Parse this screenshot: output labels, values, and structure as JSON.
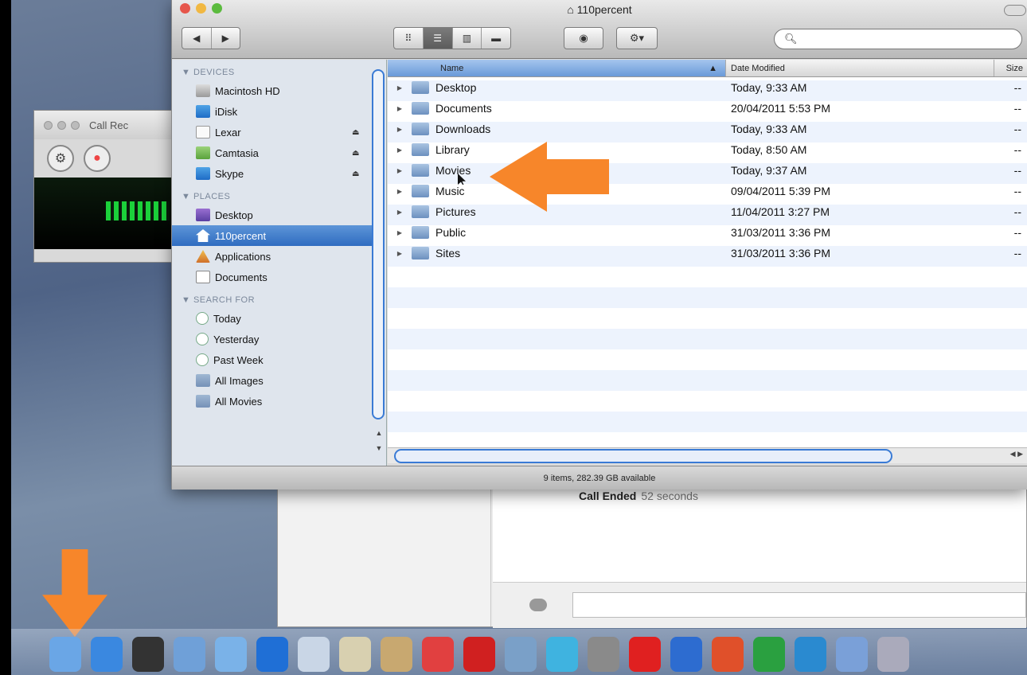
{
  "callrec": {
    "title": "Call Rec"
  },
  "chat": {
    "status": "Call Ended",
    "duration": "52 seconds"
  },
  "finder": {
    "title": "110percent",
    "search_placeholder": "",
    "view_buttons": [
      "",
      "",
      "",
      ""
    ],
    "sidebar": {
      "sections": [
        {
          "header": "▼ DEVICES",
          "items": [
            {
              "label": "Macintosh HD",
              "icon": "hd-icon",
              "eject": false
            },
            {
              "label": "iDisk",
              "icon": "idisk-icon",
              "eject": false
            },
            {
              "label": "Lexar",
              "icon": "drive-icon",
              "eject": true
            },
            {
              "label": "Camtasia",
              "icon": "disk-image-icon",
              "eject": true
            },
            {
              "label": "Skype",
              "icon": "disk-image-icon",
              "eject": true
            }
          ]
        },
        {
          "header": "▼ PLACES",
          "items": [
            {
              "label": "Desktop",
              "icon": "desktop-icon"
            },
            {
              "label": "110percent",
              "icon": "home-icon",
              "selected": true
            },
            {
              "label": "Applications",
              "icon": "applications-icon"
            },
            {
              "label": "Documents",
              "icon": "documents-icon"
            }
          ]
        },
        {
          "header": "▼ SEARCH FOR",
          "items": [
            {
              "label": "Today",
              "icon": "clock-icon"
            },
            {
              "label": "Yesterday",
              "icon": "clock-icon"
            },
            {
              "label": "Past Week",
              "icon": "clock-icon"
            },
            {
              "label": "All Images",
              "icon": "folder-icon"
            },
            {
              "label": "All Movies",
              "icon": "folder-icon"
            }
          ]
        }
      ]
    },
    "columns": {
      "name": "Name",
      "date": "Date Modified",
      "size": "Size"
    },
    "files": [
      {
        "name": "Desktop",
        "date": "Today, 9:33 AM",
        "size": "--"
      },
      {
        "name": "Documents",
        "date": "20/04/2011 5:53 PM",
        "size": "--"
      },
      {
        "name": "Downloads",
        "date": "Today, 9:33 AM",
        "size": "--"
      },
      {
        "name": "Library",
        "date": "Today, 8:50 AM",
        "size": "--"
      },
      {
        "name": "Movies",
        "date": "Today, 9:37 AM",
        "size": "--"
      },
      {
        "name": "Music",
        "date": "09/04/2011 5:39 PM",
        "size": "--"
      },
      {
        "name": "Pictures",
        "date": "11/04/2011 3:27 PM",
        "size": "--"
      },
      {
        "name": "Public",
        "date": "31/03/2011 3:36 PM",
        "size": "--"
      },
      {
        "name": "Sites",
        "date": "31/03/2011 3:36 PM",
        "size": "--"
      }
    ],
    "status": "9 items, 282.39 GB available"
  },
  "dock": {
    "items": [
      "finder-icon",
      "app-store-icon",
      "dashboard-icon",
      "preview-icon",
      "mail-icon",
      "itunes-icon",
      "facetime-icon",
      "photo-icon",
      "contacts-icon",
      "calendar-icon",
      "photobooth-icon",
      "iphoto-icon",
      "time-machine-icon",
      "system-preferences-icon",
      "vodafone-icon",
      "word-icon",
      "powerpoint-icon",
      "excel-icon",
      "messenger-icon",
      "network-icon",
      "misc-icon"
    ],
    "colors": [
      "#6aa6e6",
      "#3a88e0",
      "#333",
      "#6fa0d8",
      "#7ab2e8",
      "#1f6fd6",
      "#c9d6e6",
      "#d8d0b0",
      "#c8a870",
      "#e14040",
      "#d02020",
      "#7aa0c8",
      "#3fb3e0",
      "#8a8a8a",
      "#e02020",
      "#2d6cd0",
      "#e0502a",
      "#2aa040",
      "#2a8ad0",
      "#7aa0d8",
      "#aab"
    ]
  }
}
